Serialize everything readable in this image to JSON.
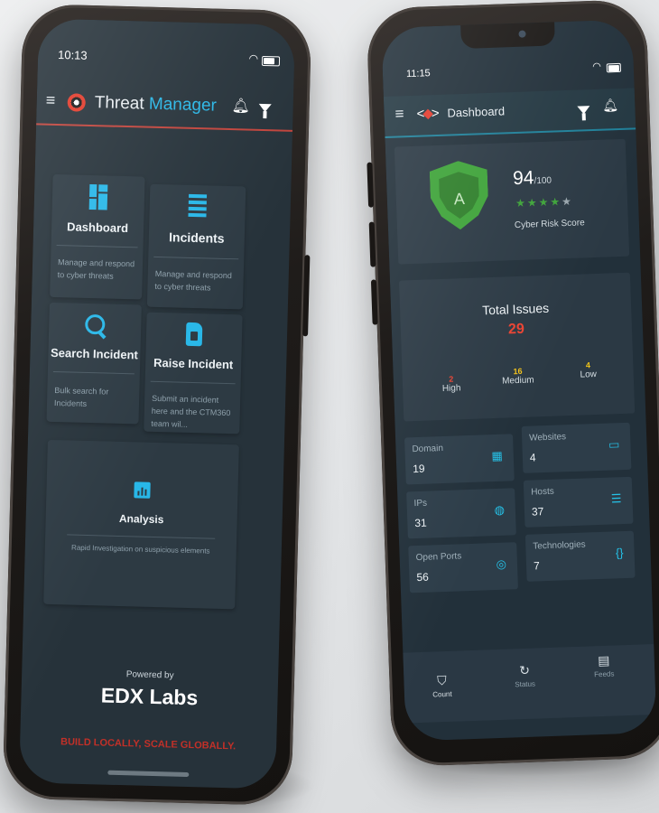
{
  "left_phone": {
    "status_bar": {
      "time": "10:13"
    },
    "app_bar": {
      "title_part1": "Threat ",
      "title_part2": "Manager"
    },
    "cards": [
      {
        "label": "Dashboard",
        "description": "Manage and respond to cyber threats",
        "icon": "dashboard-grid-icon"
      },
      {
        "label": "Incidents",
        "description": "Manage and respond to cyber threats",
        "icon": "list-icon"
      },
      {
        "label": "Search Incident",
        "description": "Bulk search for Incidents",
        "icon": "search-icon"
      },
      {
        "label": "Raise Incident",
        "description": "Submit an incident here and the CTM360 team wil...",
        "icon": "sim-card-icon"
      },
      {
        "label": "Analysis",
        "description": "Rapid Investigation on suspicious elements",
        "icon": "chart-icon"
      }
    ],
    "footer": {
      "powered_by": "Powered by",
      "brand": "EDX Labs",
      "tagline": "BUILD LOCALLY, SCALE GLOBALLY."
    }
  },
  "right_phone": {
    "status_bar": {
      "time": "11:15"
    },
    "app_bar": {
      "title": "Dashboard"
    },
    "risk": {
      "grade": "A",
      "score": "94",
      "score_suffix": "/100",
      "stars_filled": 4,
      "stars_total": 5,
      "label": "Cyber Risk Score"
    },
    "issues": {
      "title": "Total Issues",
      "total": "29",
      "high": {
        "count": "2",
        "label": "High"
      },
      "medium": {
        "count": "16",
        "label": "Medium"
      },
      "low": {
        "count": "4",
        "label": "Low"
      }
    },
    "tiles": [
      {
        "label": "Domain",
        "value": "19",
        "icon": "building-icon"
      },
      {
        "label": "Websites",
        "value": "4",
        "icon": "monitor-icon"
      },
      {
        "label": "IPs",
        "value": "31",
        "icon": "globe-icon"
      },
      {
        "label": "Hosts",
        "value": "37",
        "icon": "server-icon"
      },
      {
        "label": "Open Ports",
        "value": "56",
        "icon": "signal-icon"
      },
      {
        "label": "Technologies",
        "value": "7",
        "icon": "code-icon"
      }
    ],
    "bottom_nav": [
      {
        "label": "Count",
        "icon": "shield-icon"
      },
      {
        "label": "Status",
        "icon": "refresh-icon"
      },
      {
        "label": "Feeds",
        "icon": "document-icon"
      }
    ]
  },
  "colors": {
    "accent_blue": "#28b7e8",
    "brand_red": "#e23b2b",
    "shield_green": "#3ea339",
    "medium_yellow": "#f2c21b",
    "low_yellow": "#f0c419"
  }
}
